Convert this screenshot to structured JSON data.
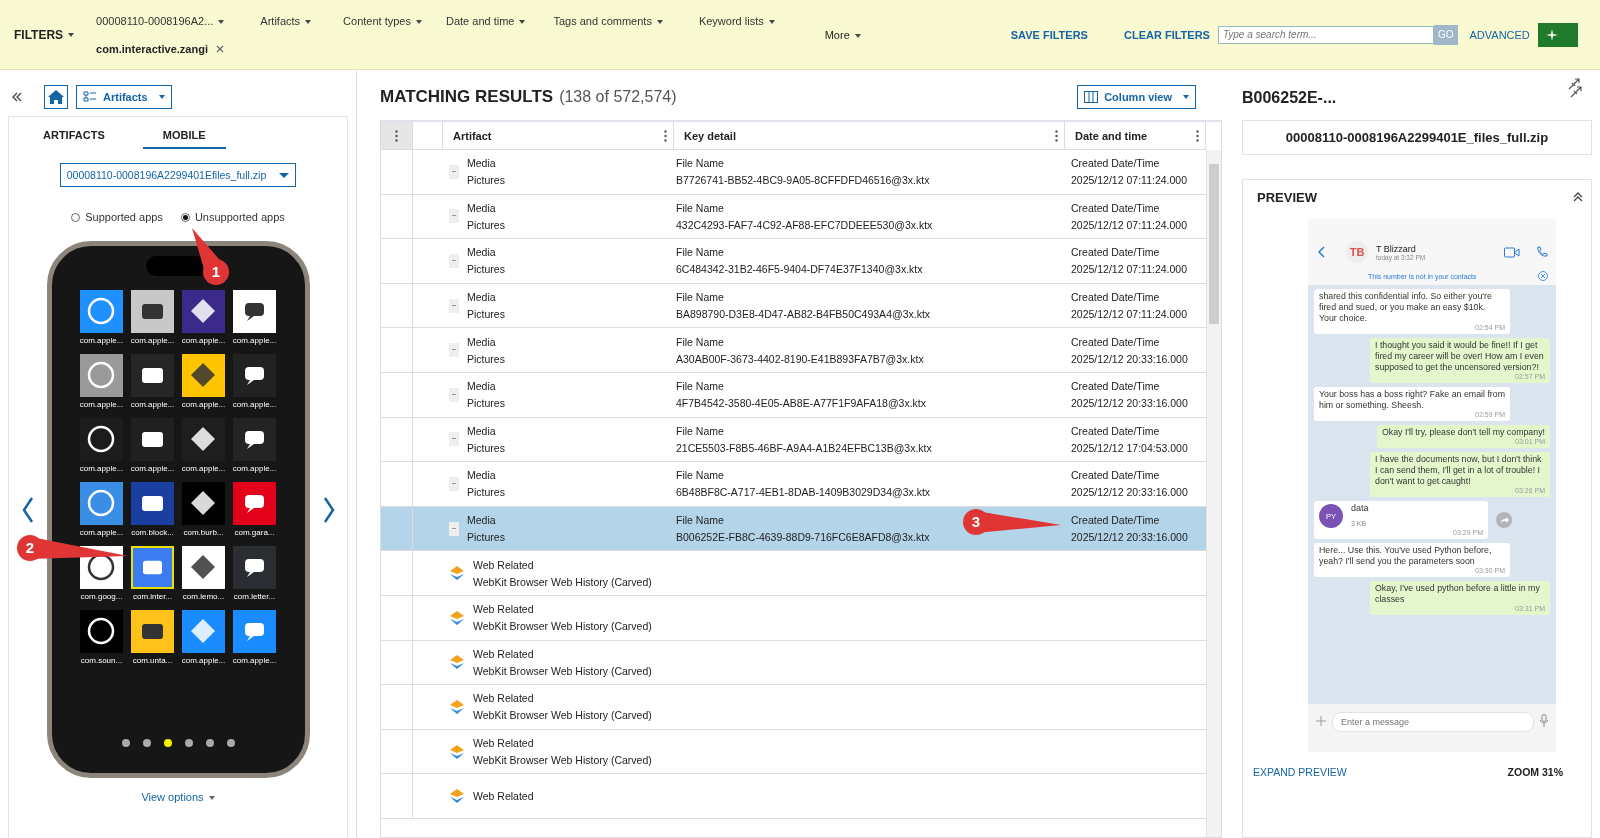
{
  "filter_bar": {
    "title": "FILTERS",
    "filters": [
      {
        "label": "00008110-0008196A2..."
      },
      {
        "label": "Artifacts"
      },
      {
        "label": "Content types"
      },
      {
        "label": "Date and time"
      },
      {
        "label": "Tags and comments"
      },
      {
        "label": "Keyword lists"
      }
    ],
    "chip": "com.interactive.zangi",
    "more": "More",
    "save": "SAVE FILTERS",
    "clear": "CLEAR FILTERS",
    "search": {
      "placeholder": "Type a search term..."
    },
    "go": "GO",
    "advanced": "ADVANCED"
  },
  "left_panel": {
    "view_menu": "Artifacts",
    "tabs": [
      {
        "label": "ARTIFACTS",
        "selected": false
      },
      {
        "label": "MOBILE",
        "selected": true
      }
    ],
    "source": "00008110-0008196A2299401Efiles_full.zip",
    "radios": [
      {
        "label": "Supported apps",
        "selected": false
      },
      {
        "label": "Unsupported apps",
        "selected": true
      }
    ],
    "apps": [
      {
        "label": "com.apple...",
        "color": "#1e90ff",
        "selected": false
      },
      {
        "label": "com.apple...",
        "color": "#c8c8c8",
        "selected": false
      },
      {
        "label": "com.apple...",
        "color": "#3b2a8a",
        "selected": false
      },
      {
        "label": "com.apple...",
        "color": "#ffffff",
        "selected": false
      },
      {
        "label": "com.apple...",
        "color": "#9a9a9a",
        "selected": false
      },
      {
        "label": "com.apple...",
        "color": "#262626",
        "selected": false
      },
      {
        "label": "com.apple...",
        "color": "#ffc400",
        "selected": false
      },
      {
        "label": "com.apple...",
        "color": "#222222",
        "selected": false
      },
      {
        "label": "com.apple...",
        "color": "#1c1c1c",
        "selected": false
      },
      {
        "label": "com.apple...",
        "color": "#202020",
        "selected": false
      },
      {
        "label": "com.apple...",
        "color": "#1e1e1e",
        "selected": false
      },
      {
        "label": "com.apple...",
        "color": "#242424",
        "selected": false
      },
      {
        "label": "com.apple...",
        "color": "#3a8ee6",
        "selected": false
      },
      {
        "label": "com.block...",
        "color": "#1b3fa0",
        "selected": false
      },
      {
        "label": "com.burb...",
        "color": "#000000",
        "selected": false
      },
      {
        "label": "com.gara...",
        "color": "#e3001b",
        "selected": false
      },
      {
        "label": "com.goog...",
        "color": "#ffffff",
        "selected": false
      },
      {
        "label": "com.inter...",
        "color": "#3d7cf0",
        "selected": true
      },
      {
        "label": "com.lemo...",
        "color": "#ffffff",
        "selected": false
      },
      {
        "label": "com.letter...",
        "color": "#2a2e33",
        "selected": false
      },
      {
        "label": "com.soun...",
        "color": "#000000",
        "selected": false
      },
      {
        "label": "com.unta...",
        "color": "#ffc21a",
        "selected": false
      },
      {
        "label": "com.apple...",
        "color": "#1a8cff",
        "selected": false
      },
      {
        "label": "com.apple...",
        "color": "#1a8cff",
        "selected": false
      }
    ],
    "pages": [
      {
        "selected": false
      },
      {
        "selected": false
      },
      {
        "selected": true
      },
      {
        "selected": false
      },
      {
        "selected": false
      },
      {
        "selected": false
      }
    ],
    "view_options": "View options"
  },
  "results": {
    "title": "MATCHING RESULTS",
    "count": "(138 of 572,574)",
    "column_view": "Column view",
    "columns": [
      "Artifact",
      "Key detail",
      "Date and time"
    ],
    "rows": [
      {
        "kind": "media",
        "category": "Media",
        "type": "Pictures",
        "detail_label": "File Name",
        "detail": "B7726741-BB52-4BC9-9A05-8CFFDFD46516@3x.ktx",
        "date_label": "Created Date/Time",
        "date": "2025/12/12 07:11:24.000",
        "selected": false
      },
      {
        "kind": "media",
        "category": "Media",
        "type": "Pictures",
        "detail_label": "File Name",
        "detail": "432C4293-FAF7-4C92-AF88-EFC7DDEEE530@3x.ktx",
        "date_label": "Created Date/Time",
        "date": "2025/12/12 07:11:24.000",
        "selected": false
      },
      {
        "kind": "media",
        "category": "Media",
        "type": "Pictures",
        "detail_label": "File Name",
        "detail": "6C484342-31B2-46F5-9404-DF74E37F1340@3x.ktx",
        "date_label": "Created Date/Time",
        "date": "2025/12/12 07:11:24.000",
        "selected": false
      },
      {
        "kind": "media",
        "category": "Media",
        "type": "Pictures",
        "detail_label": "File Name",
        "detail": "BA898790-D3E8-4D47-AB82-B4FB50C493A4@3x.ktx",
        "date_label": "Created Date/Time",
        "date": "2025/12/12 07:11:24.000",
        "selected": false
      },
      {
        "kind": "media",
        "category": "Media",
        "type": "Pictures",
        "detail_label": "File Name",
        "detail": "A30AB00F-3673-4402-8190-E41B893FA7B7@3x.ktx",
        "date_label": "Created Date/Time",
        "date": "2025/12/12 20:33:16.000",
        "selected": false
      },
      {
        "kind": "media",
        "category": "Media",
        "type": "Pictures",
        "detail_label": "File Name",
        "detail": "4F7B4542-3580-4E05-AB8E-A77F1F9AFA18@3x.ktx",
        "date_label": "Created Date/Time",
        "date": "2025/12/12 20:33:16.000",
        "selected": false
      },
      {
        "kind": "media",
        "category": "Media",
        "type": "Pictures",
        "detail_label": "File Name",
        "detail": "21CE5503-F8B5-46BF-A9A4-A1B24EFBC13B@3x.ktx",
        "date_label": "Created Date/Time",
        "date": "2025/12/12 17:04:53.000",
        "selected": false
      },
      {
        "kind": "media",
        "category": "Media",
        "type": "Pictures",
        "detail_label": "File Name",
        "detail": "6B48BF8C-A717-4EB1-8DAB-1409B3029D34@3x.ktx",
        "date_label": "Created Date/Time",
        "date": "2025/12/12 20:33:16.000",
        "selected": false
      },
      {
        "kind": "media",
        "category": "Media",
        "type": "Pictures",
        "detail_label": "File Name",
        "detail": "B006252E-FB8C-4639-88D9-716FC6E8AFD8@3x.ktx",
        "date_label": "Created Date/Time",
        "date": "2025/12/12 20:33:16.000",
        "selected": true
      },
      {
        "kind": "web",
        "category": "Web Related",
        "type": "WebKit Browser Web History (Carved)",
        "selected": false
      },
      {
        "kind": "web",
        "category": "Web Related",
        "type": "WebKit Browser Web History (Carved)",
        "selected": false
      },
      {
        "kind": "web",
        "category": "Web Related",
        "type": "WebKit Browser Web History (Carved)",
        "selected": false
      },
      {
        "kind": "web",
        "category": "Web Related",
        "type": "WebKit Browser Web History (Carved)",
        "selected": false
      },
      {
        "kind": "web",
        "category": "Web Related",
        "type": "WebKit Browser Web History (Carved)",
        "selected": false
      },
      {
        "kind": "web",
        "category": "Web Related",
        "selected": false
      }
    ]
  },
  "detail_panel": {
    "title": "B006252E-...",
    "file": "00008110-0008196A2299401E_files_full.zip",
    "preview_title": "PREVIEW",
    "chat": {
      "initials": "TB",
      "contact": "T Blizzard",
      "last_seen": "today at 3:32 PM",
      "notice": "This number is not in your contacts",
      "messages": [
        {
          "kind": "in",
          "text": "shared this confidential info. So either you're fired and sued, or you make an easy $10k. Your choice.",
          "time": "02:54 PM"
        },
        {
          "kind": "out",
          "text": "I thought you said it would be fine!! If I get fired my career will be over! How am I even supposed to get the uncensored version?!",
          "time": "02:57 PM"
        },
        {
          "kind": "in",
          "text": "Your boss has a boss right? Fake an email from him or something. Sheesh.",
          "time": "02:59 PM"
        },
        {
          "kind": "out",
          "text": "Okay I'll try, please don't tell my company!",
          "time": "03:01 PM"
        },
        {
          "kind": "out",
          "text": "I have the documents now, but I don't think I can send them, I'll get in a lot of trouble! I don't want to get caught!",
          "time": "03:26 PM"
        },
        {
          "kind": "file",
          "badge": "PY",
          "text": "data",
          "size": "3 KB",
          "time": "03:29 PM"
        },
        {
          "kind": "in",
          "text": "Here... Use this. You've used Python before, yeah? I'll send you the parameters soon",
          "time": "03:30 PM"
        },
        {
          "kind": "out",
          "text": "Okay, I've used python before a little in my classes",
          "time": "03:31 PM"
        }
      ],
      "input": {
        "placeholder": "Enter a message"
      }
    },
    "expand": "EXPAND PREVIEW",
    "zoom": "ZOOM 31%"
  },
  "annotations": [
    {
      "label": "1"
    },
    {
      "label": "2"
    },
    {
      "label": "3"
    }
  ]
}
